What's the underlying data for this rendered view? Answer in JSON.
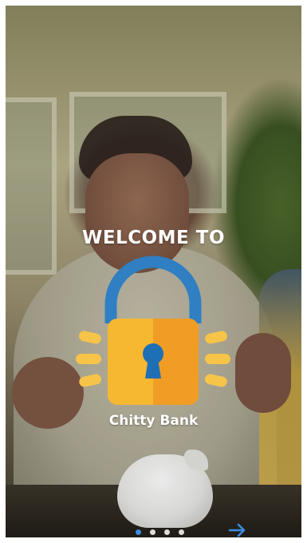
{
  "welcome": {
    "heading": "WELCOME TO",
    "brand_name": "Chitty Bank"
  },
  "logo": {
    "icon": "padlock-icon",
    "colors": {
      "shackle": "#2f7fc2",
      "body_left": "#f6b731",
      "body_right": "#f09c25",
      "keyhole": "#1f6fb5",
      "rays": "#f7c44a"
    }
  },
  "pager": {
    "total_pages": 4,
    "current_page": 1,
    "active_color": "#3a8de0"
  },
  "next": {
    "icon": "arrow-right-icon",
    "color": "#3a8de0"
  }
}
